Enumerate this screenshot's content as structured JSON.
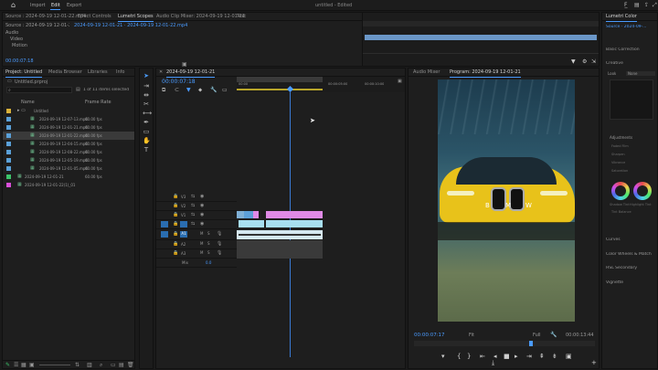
{
  "topbar": {
    "home": "⌂",
    "import": "Import",
    "edit": "Edit",
    "export": "Export",
    "title": "untitled - Edited",
    "icons": [
      "help-icon",
      "panel-icon",
      "share-icon",
      "expand-icon"
    ]
  },
  "source_tabs": {
    "items": [
      "Source : 2024-09-19 12-01-22.mp4",
      "Effect Controls",
      "Lumetri Scopes",
      "Audio Clip Mixer: 2024-09-19 12-01-21",
      "Text"
    ],
    "active_index": 2
  },
  "effect_controls": {
    "clip_path": "Source : 2024-09-19 12-01-22.mp4 ▾",
    "sequence": "2024-09-19 12-01-21 · 2024-09-19 12-01-22.mp4",
    "timecode": "00:00:07:18",
    "rows": [
      "Video",
      "Motion",
      "Opacity"
    ],
    "section": "Audio",
    "mini_timecode": "00:00:00:00"
  },
  "project": {
    "tabs": [
      "Project: Untitled",
      "Media Browser",
      "Libraries",
      "Info"
    ],
    "file": "Untitled.prproj",
    "search_placeholder": "",
    "item_count": "1 of 11 items selected",
    "col_name": "Name",
    "col_rate": "Frame Rate",
    "items": [
      {
        "name": "Untitled",
        "rate": "",
        "color": "#d9b13a",
        "indent": 0,
        "folder": true,
        "selected": false
      },
      {
        "name": "2024-09-19 12-07-13.mp4",
        "rate": "60.00 fps",
        "color": "#5aa0d8",
        "indent": 1,
        "folder": false,
        "selected": false
      },
      {
        "name": "2024-09-19 12-01-21.mp4",
        "rate": "60.00 fps",
        "color": "#5aa0d8",
        "indent": 1,
        "folder": false,
        "selected": false
      },
      {
        "name": "2024-09-19 12-01-22.mp4",
        "rate": "60.00 fps",
        "color": "#5aa0d8",
        "indent": 1,
        "folder": false,
        "selected": true
      },
      {
        "name": "2024-09-19 12-04-15.mp4",
        "rate": "60.00 fps",
        "color": "#5aa0d8",
        "indent": 1,
        "folder": false,
        "selected": false
      },
      {
        "name": "2024-09-19 12-08-22.mp4",
        "rate": "60.00 fps",
        "color": "#5aa0d8",
        "indent": 1,
        "folder": false,
        "selected": false
      },
      {
        "name": "2024-09-19 12-05-19.mp4",
        "rate": "60.00 fps",
        "color": "#5aa0d8",
        "indent": 1,
        "folder": false,
        "selected": false
      },
      {
        "name": "2024-09-19 12-01-05.mp4",
        "rate": "60.00 fps",
        "color": "#5aa0d8",
        "indent": 1,
        "folder": false,
        "selected": false
      },
      {
        "name": "2024-09-19 12-01-21",
        "rate": "60.00 fps",
        "color": "#3cc46a",
        "indent": 0,
        "folder": false,
        "selected": false
      },
      {
        "name": "2024-09-19 12-01-22(1)_01",
        "rate": "",
        "color": "#d94fd9",
        "indent": 0,
        "folder": false,
        "selected": false
      }
    ]
  },
  "tools": [
    "selection-tool",
    "track-select-tool",
    "ripple-edit-tool",
    "razor-tool",
    "slip-tool",
    "pen-tool",
    "rectangle-tool",
    "hand-tool",
    "type-tool"
  ],
  "timeline": {
    "tab": "2024-09-19 12-01-21",
    "timecode": "00:00:07:18",
    "ruler": [
      "00:00",
      "00:00:05:00",
      "00:00:10:00"
    ],
    "video_tracks": [
      "V3",
      "V2",
      "V1"
    ],
    "audio_tracks": [
      "A1",
      "A2",
      "A3"
    ],
    "mix_label": "Mix",
    "mix_value": "0.0"
  },
  "program": {
    "tabs": [
      "Audio Mixer",
      "Program: 2024-09-19 12-01-21"
    ],
    "timecode": "00:00:07:17",
    "fit": "Fit",
    "quality": "Full",
    "duration": "00:00:13:44",
    "logo_letters": [
      "B",
      "M",
      "W"
    ]
  },
  "lumetri": {
    "title": "Lumetri Color",
    "source": "Source · 2024-09-...",
    "sections": [
      "Basic Correction",
      "Creative",
      "Curves",
      "Color Wheels & Match",
      "HSL Secondary",
      "Vignette"
    ],
    "look_label": "Look",
    "look_value": "None",
    "adjustments": "Adjustments",
    "sliders": [
      "Faded Film",
      "Sharpen",
      "Vibrance",
      "Saturation"
    ],
    "tint_label": "Shadow Tint",
    "highlight_label": "Highlight Tint",
    "tint_balance": "Tint Balance"
  },
  "colors": {
    "accent": "#4a9bff",
    "clip_video": "#a8dff0",
    "clip_pink": "#e08ae6",
    "car_yellow": "#e8c21a"
  }
}
